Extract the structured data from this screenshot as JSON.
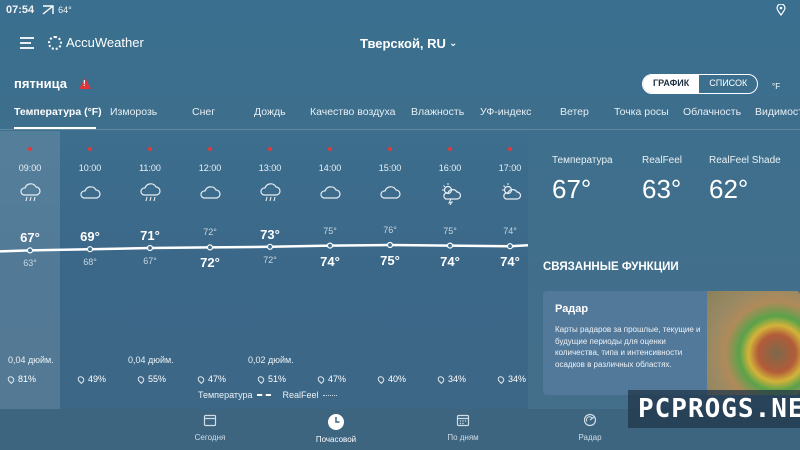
{
  "status": {
    "time": "07:54",
    "temp": "64°"
  },
  "header": {
    "brand": "AccuWeather",
    "city": "Тверской, RU"
  },
  "day": {
    "label": "пятница"
  },
  "view_toggle": {
    "chart": "ГРАФИК",
    "list": "СПИСОК"
  },
  "unit": "°F",
  "tabs": [
    {
      "label": "Температура (°F)"
    },
    {
      "label": "Изморозь"
    },
    {
      "label": "Снег"
    },
    {
      "label": "Дождь"
    },
    {
      "label": "Качество воздуха"
    },
    {
      "label": "Влажность"
    },
    {
      "label": "УФ-индекс"
    },
    {
      "label": "Ветер"
    },
    {
      "label": "Точка росы"
    },
    {
      "label": "Облачность"
    },
    {
      "label": "Видимость"
    }
  ],
  "hours": [
    {
      "time": "09:00",
      "icon": "rain-icon",
      "temp": "67°",
      "realfeel": "63°",
      "precip": "0,04 дюйм.",
      "humidity": "81%"
    },
    {
      "time": "10:00",
      "icon": "cloud-icon",
      "temp": "69°",
      "realfeel": "68°",
      "precip": "",
      "humidity": "49%"
    },
    {
      "time": "11:00",
      "icon": "rain-icon",
      "temp": "71°",
      "realfeel": "67°",
      "precip": "0,04 дюйм.",
      "humidity": "55%"
    },
    {
      "time": "12:00",
      "icon": "cloud-icon",
      "temp": "72°",
      "realfeel": "72°",
      "precip": "",
      "humidity": "47%"
    },
    {
      "time": "13:00",
      "icon": "rain-icon",
      "temp": "73°",
      "realfeel": "72°",
      "precip": "0,02 дюйм.",
      "humidity": "51%"
    },
    {
      "time": "14:00",
      "icon": "cloud-icon",
      "temp": "75°",
      "realfeel": "74°",
      "precip": "",
      "humidity": "47%"
    },
    {
      "time": "15:00",
      "icon": "cloud-icon",
      "temp": "76°",
      "realfeel": "75°",
      "precip": "",
      "humidity": "40%"
    },
    {
      "time": "16:00",
      "icon": "partly-sunny-storm-icon",
      "temp": "75°",
      "realfeel": "74°",
      "precip": "",
      "humidity": "34%"
    },
    {
      "time": "17:00",
      "icon": "partly-sunny-icon",
      "temp": "74°",
      "realfeel": "74°",
      "precip": "",
      "humidity": "34%"
    }
  ],
  "legend": {
    "temperature": "Температура",
    "realfeel": "RealFeel"
  },
  "current": {
    "temperature_label": "Температура",
    "temperature": "67°",
    "realfeel_label": "RealFeel",
    "realfeel": "63°",
    "shade_label": "RealFeel Shade",
    "shade": "62°"
  },
  "related": {
    "title": "СВЯЗАННЫЕ ФУНКЦИИ",
    "card_title": "Радар",
    "card_desc": "Карты радаров за прошлые, текущие и будущие периоды для оценки количества, типа и интенсивности осадков в различных областях."
  },
  "nav": [
    {
      "label": "Сегодня"
    },
    {
      "label": "Почасовой"
    },
    {
      "label": "По дням"
    },
    {
      "label": "Радар"
    }
  ],
  "watermark": "PCPROGS.NET",
  "colors": {
    "accent": "#e03a3a",
    "background": "#3d6e8d"
  }
}
